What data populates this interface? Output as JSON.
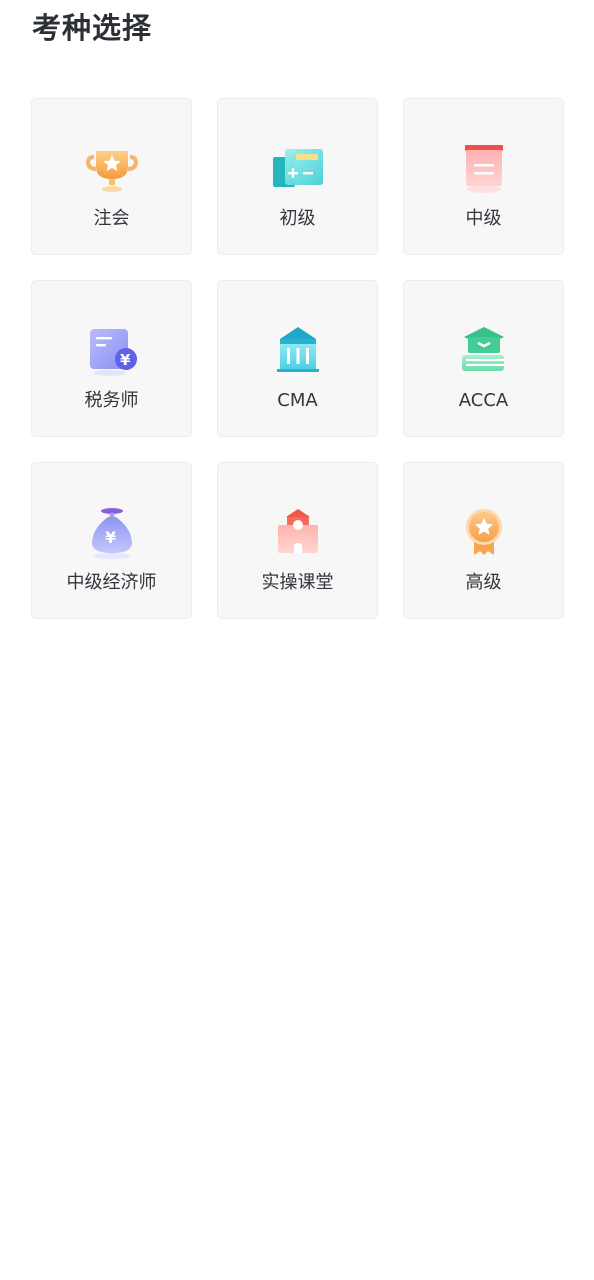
{
  "page_title": "考种选择",
  "exam_types": [
    {
      "label": "注会",
      "icon": "trophy-icon",
      "color": "#f7a24a"
    },
    {
      "label": "初级",
      "icon": "calculator-icon",
      "color": "#2bc3c9"
    },
    {
      "label": "中级",
      "icon": "document-icon",
      "color": "#f25c5c"
    },
    {
      "label": "税务师",
      "icon": "tax-invoice-icon",
      "color": "#7b83f2"
    },
    {
      "label": "CMA",
      "icon": "bank-building-icon",
      "color": "#2bb8d6"
    },
    {
      "label": "ACCA",
      "icon": "graduation-book-icon",
      "color": "#3ec98f"
    },
    {
      "label": "中级经济师",
      "icon": "money-bag-icon",
      "color": "#8a8ff0"
    },
    {
      "label": "实操课堂",
      "icon": "school-building-icon",
      "color": "#f0604d"
    },
    {
      "label": "高级",
      "icon": "medal-icon",
      "color": "#f7a24a"
    }
  ]
}
